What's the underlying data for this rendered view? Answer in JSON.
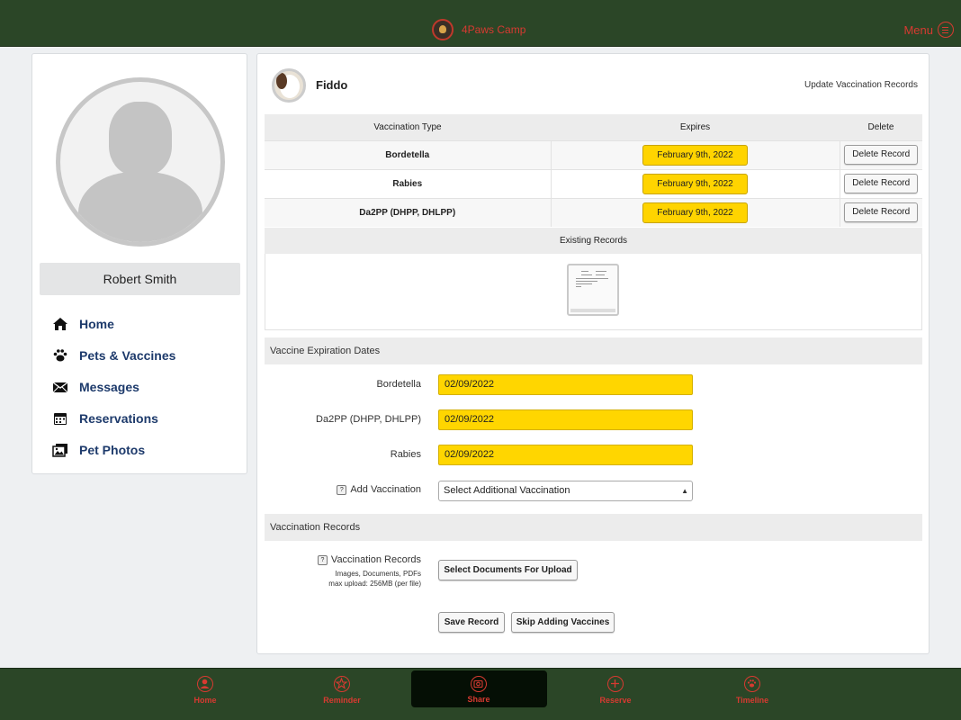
{
  "header": {
    "brand": "4Paws Camp",
    "menu_label": "Menu"
  },
  "profile": {
    "name": "Robert Smith"
  },
  "nav": {
    "items": [
      {
        "label": "Home",
        "icon": "home-icon"
      },
      {
        "label": "Pets & Vaccines",
        "icon": "paw-icon"
      },
      {
        "label": "Messages",
        "icon": "envelope-icon"
      },
      {
        "label": "Reservations",
        "icon": "calendar-icon"
      },
      {
        "label": "Pet Photos",
        "icon": "photos-icon"
      }
    ]
  },
  "pet": {
    "name": "Fiddo",
    "update_link": "Update Vaccination Records"
  },
  "vaccine_table": {
    "headers": [
      "Vaccination Type",
      "Expires",
      "Delete"
    ],
    "rows": [
      {
        "type": "Bordetella",
        "expires": "February 9th, 2022",
        "action": "Delete Record"
      },
      {
        "type": "Rabies",
        "expires": "February 9th, 2022",
        "action": "Delete Record"
      },
      {
        "type": "Da2PP (DHPP, DHLPP)",
        "expires": "February 9th, 2022",
        "action": "Delete Record"
      }
    ],
    "existing_records_label": "Existing Records"
  },
  "expiration_section": {
    "title": "Vaccine Expiration Dates",
    "fields": [
      {
        "label": "Bordetella",
        "value": "02/09/2022"
      },
      {
        "label": "Da2PP (DHPP, DHLPP)",
        "value": "02/09/2022"
      },
      {
        "label": "Rabies",
        "value": "02/09/2022"
      }
    ],
    "add_vaccination_label": "Add Vaccination",
    "add_vaccination_select": "Select Additional Vaccination"
  },
  "records_section": {
    "title": "Vaccination Records",
    "label": "Vaccination Records",
    "note_line1": "Images, Documents, PDFs",
    "note_line2": "max upload: 256MB (per file)",
    "upload_button": "Select Documents For Upload",
    "save_button": "Save Record",
    "skip_button": "Skip Adding Vaccines"
  },
  "colors": {
    "brand_green": "#2b4627",
    "accent_red": "#d73a31",
    "date_yellow": "#ffd400",
    "nav_blue": "#1d3a6b"
  },
  "bottom_tabs": [
    {
      "label": "Home",
      "icon": "user-circle-icon"
    },
    {
      "label": "Reminder",
      "icon": "star-icon"
    },
    {
      "label": "Share",
      "icon": "camera-icon",
      "active": true
    },
    {
      "label": "Reserve",
      "icon": "plus-circle-icon"
    },
    {
      "label": "Timeline",
      "icon": "paw-circle-icon"
    }
  ]
}
